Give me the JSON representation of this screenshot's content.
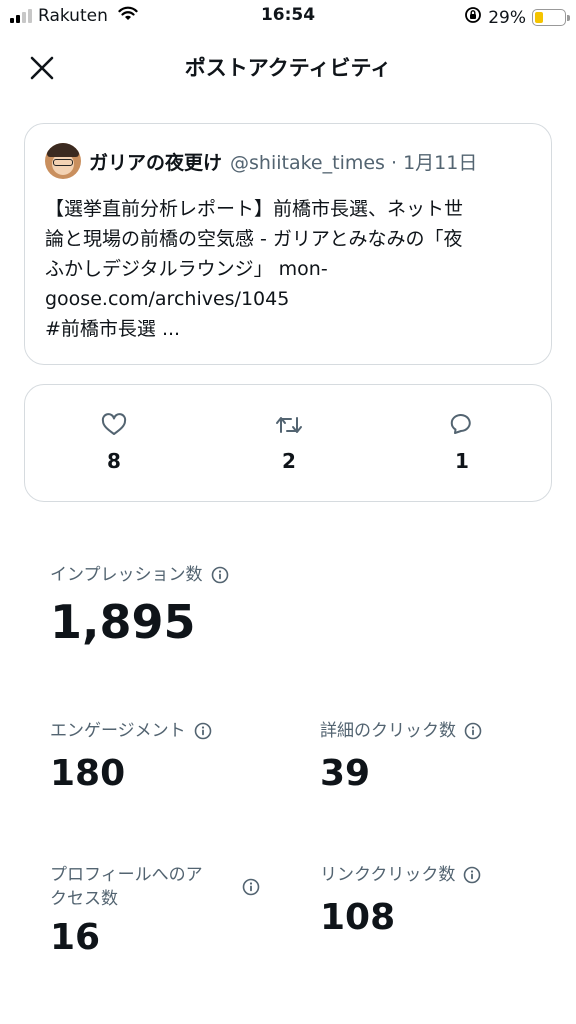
{
  "status_bar": {
    "carrier": "Rakuten",
    "time": "16:54",
    "battery_percent": "29%",
    "battery_level": 0.29,
    "icons": [
      "signal-icon",
      "wifi-icon",
      "rotation-lock-icon",
      "battery-icon"
    ]
  },
  "header": {
    "title": "ポストアクティビティ",
    "close_icon": "close-icon"
  },
  "tweet": {
    "author": "ガリアの夜更け",
    "handle_date": "@shiitake_times · 1月11日",
    "text": "【選挙直前分析レポート】前橋市長選、ネット世\n論と現場の前橋の空気感 - ガリアとみなみの「夜\nふかしデジタルラウンジ」 mon-\ngoose.com/archives/1045\n#前橋市長選 ..."
  },
  "engagement": {
    "likes": "8",
    "reposts": "2",
    "replies": "1"
  },
  "metrics": {
    "impressions_label": "インプレッション数",
    "impressions_value": "1,895",
    "engagements_label": "エンゲージメント",
    "engagements_value": "180",
    "detail_clicks_label": "詳細のクリック数",
    "detail_clicks_value": "39",
    "profile_visits_label": "プロフィールへのア\nクセス数",
    "profile_visits_value": "16",
    "link_clicks_label": "リンククリック数",
    "link_clicks_value": "108"
  },
  "colors": {
    "text": "#0f1419",
    "secondary": "#536471",
    "border": "#d6dbdf",
    "battery": "#f5c400"
  }
}
